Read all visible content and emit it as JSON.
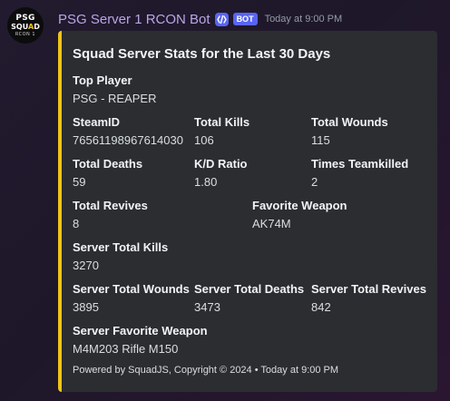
{
  "message": {
    "avatar": {
      "line1": "PSG",
      "line2": "SQUAD",
      "line3": "RCON 1"
    },
    "username": "PSG Server 1 RCON Bot",
    "bot_tag": "BOT",
    "timestamp": "Today at 9:00 PM",
    "app_icon": "app-command-icon",
    "embed": {
      "accent_color": "#f0c419",
      "title": "Squad Server Stats for the Last 30 Days",
      "fields": [
        {
          "name": "Top Player",
          "value": "PSG - REAPER"
        },
        {
          "name": "SteamID",
          "value": "76561198967614030"
        },
        {
          "name": "Total Kills",
          "value": "106"
        },
        {
          "name": "Total Wounds",
          "value": "115"
        },
        {
          "name": "Total Deaths",
          "value": "59"
        },
        {
          "name": "K/D Ratio",
          "value": "1.80"
        },
        {
          "name": "Times Teamkilled",
          "value": "2"
        },
        {
          "name": "Total Revives",
          "value": "8"
        },
        {
          "name": "Favorite Weapon",
          "value": "AK74M"
        },
        {
          "name": "Server Total Kills",
          "value": "3270"
        },
        {
          "name": "Server Total Wounds",
          "value": "3895"
        },
        {
          "name": "Server Total Deaths",
          "value": "3473"
        },
        {
          "name": "Server Total Revives",
          "value": "842"
        },
        {
          "name": "Server Favorite Weapon",
          "value": "M4M203 Rifle M150"
        }
      ],
      "footer": "Powered by SquadJS, Copyright © 2024 • Today at 9:00 PM"
    }
  }
}
